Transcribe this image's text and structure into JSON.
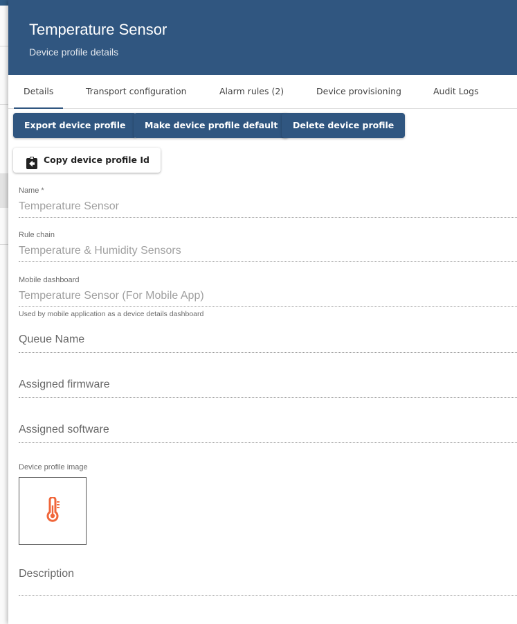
{
  "header": {
    "title": "Temperature Sensor",
    "subtitle": "Device profile details"
  },
  "tabs": [
    {
      "label": "Details",
      "active": true
    },
    {
      "label": "Transport configuration",
      "active": false
    },
    {
      "label": "Alarm rules (2)",
      "active": false
    },
    {
      "label": "Device provisioning",
      "active": false
    },
    {
      "label": "Audit Logs",
      "active": false
    }
  ],
  "actions": {
    "export": "Export device profile",
    "make_default": "Make device profile default",
    "delete": "Delete device profile",
    "copy_id": "Copy device profile Id"
  },
  "form": {
    "name": {
      "label": "Name *",
      "value": "Temperature Sensor"
    },
    "rule_chain": {
      "label": "Rule chain",
      "value": "Temperature & Humidity Sensors"
    },
    "mobile_dashboard": {
      "label": "Mobile dashboard",
      "value": "Temperature Sensor (For Mobile App)",
      "hint": "Used by mobile application as a device details dashboard"
    },
    "queue_name": {
      "placeholder": "Queue Name"
    },
    "assigned_firmware": {
      "placeholder": "Assigned firmware"
    },
    "assigned_software": {
      "placeholder": "Assigned software"
    },
    "profile_image": {
      "label": "Device profile image",
      "icon": "thermometer-icon"
    },
    "description": {
      "placeholder": "Description"
    }
  },
  "colors": {
    "primary": "#305680",
    "icon_accent": "#f0663a"
  }
}
